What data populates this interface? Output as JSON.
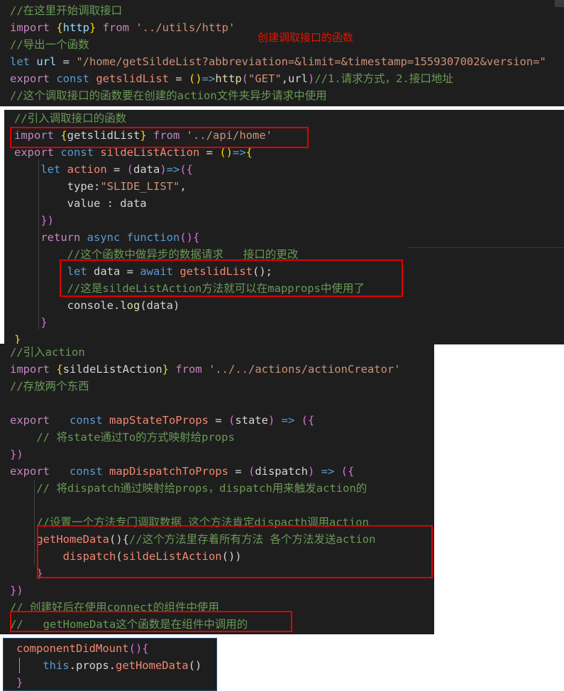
{
  "panel1": {
    "lines": [
      [
        {
          "t": "//在这里开始调取接口",
          "c": "c"
        }
      ],
      [
        {
          "t": "import ",
          "c": "kp"
        },
        {
          "t": "{",
          "c": "y"
        },
        {
          "t": "http",
          "c": "v"
        },
        {
          "t": "} ",
          "c": "y"
        },
        {
          "t": "from ",
          "c": "kp"
        },
        {
          "t": "'../utils/http'",
          "c": "s"
        }
      ],
      [
        {
          "t": "//导出一个函数",
          "c": "c"
        }
      ],
      [
        {
          "t": "let ",
          "c": "k"
        },
        {
          "t": "url ",
          "c": "v"
        },
        {
          "t": "= ",
          "c": "w"
        },
        {
          "t": "\"/home/getSildeList?abbreviation=&limit=&timestamp=1559307002&version=\"",
          "c": "s"
        }
      ],
      [
        {
          "t": "export ",
          "c": "kp"
        },
        {
          "t": "const ",
          "c": "k"
        },
        {
          "t": "getslidList ",
          "c": "f2"
        },
        {
          "t": "= ",
          "c": "w"
        },
        {
          "t": "()",
          "c": "y"
        },
        {
          "t": "=>",
          "c": "k"
        },
        {
          "t": "http",
          "c": "f"
        },
        {
          "t": "(",
          "c": "pk"
        },
        {
          "t": "\"GET\"",
          "c": "s"
        },
        {
          "t": ",url",
          "c": "w"
        },
        {
          "t": ")",
          "c": "pk"
        },
        {
          "t": "//1.请求方式，2.接口地址",
          "c": "c"
        }
      ],
      [
        {
          "t": "//这个调取接口的函数要在创建的action文件夹异步请求中使用",
          "c": "c"
        }
      ]
    ],
    "annotation": "创建调取接口的函数"
  },
  "panel2": {
    "lines": [
      [
        {
          "t": "//引入调取接口的函数",
          "c": "c"
        }
      ],
      [
        {
          "t": "import ",
          "c": "kp"
        },
        {
          "t": "{",
          "c": "y"
        },
        {
          "t": "getslidList",
          "c": "w"
        },
        {
          "t": "} ",
          "c": "y"
        },
        {
          "t": "from ",
          "c": "kp"
        },
        {
          "t": "'../api/home'",
          "c": "s"
        }
      ],
      [
        {
          "t": "export ",
          "c": "kp"
        },
        {
          "t": "const ",
          "c": "k"
        },
        {
          "t": "sildeListAction ",
          "c": "f2"
        },
        {
          "t": "= ",
          "c": "w"
        },
        {
          "t": "()",
          "c": "y"
        },
        {
          "t": "=>",
          "c": "k"
        },
        {
          "t": "{",
          "c": "y"
        }
      ],
      [
        {
          "t": "    let ",
          "c": "k"
        },
        {
          "t": "action ",
          "c": "f2"
        },
        {
          "t": "= ",
          "c": "w"
        },
        {
          "t": "(",
          "c": "pk"
        },
        {
          "t": "data",
          "c": "w"
        },
        {
          "t": ")",
          "c": "pk"
        },
        {
          "t": "=>",
          "c": "k"
        },
        {
          "t": "({",
          "c": "pk"
        }
      ],
      [
        {
          "t": "        type:",
          "c": "w"
        },
        {
          "t": "\"SLIDE_LIST\"",
          "c": "s"
        },
        {
          "t": ",",
          "c": "w"
        }
      ],
      [
        {
          "t": "        value : data",
          "c": "w"
        }
      ],
      [
        {
          "t": "    })",
          "c": "pk"
        }
      ],
      [
        {
          "t": "    return ",
          "c": "kp"
        },
        {
          "t": "async ",
          "c": "k"
        },
        {
          "t": "function",
          "c": "k"
        },
        {
          "t": "(){",
          "c": "pk"
        }
      ],
      [
        {
          "t": "        //这个函数中做异步的数据请求   接口的更改",
          "c": "c"
        }
      ],
      [
        {
          "t": "        let ",
          "c": "k"
        },
        {
          "t": "data ",
          "c": "w"
        },
        {
          "t": "= ",
          "c": "w"
        },
        {
          "t": "await ",
          "c": "k"
        },
        {
          "t": "getslidList",
          "c": "f2"
        },
        {
          "t": "();",
          "c": "w"
        }
      ],
      [
        {
          "t": "        //这是sildeListAction方法就可以在mapprops中使用了",
          "c": "c"
        }
      ],
      [
        {
          "t": "        console.",
          "c": "w"
        },
        {
          "t": "log",
          "c": "f"
        },
        {
          "t": "(data)",
          "c": "w"
        }
      ],
      [
        {
          "t": "    }",
          "c": "pk"
        }
      ],
      [
        {
          "t": "}",
          "c": "y"
        }
      ]
    ]
  },
  "panel3": {
    "lines": [
      [
        {
          "t": "//引入action",
          "c": "c"
        }
      ],
      [
        {
          "t": "import ",
          "c": "kp"
        },
        {
          "t": "{",
          "c": "y"
        },
        {
          "t": "sildeListAction",
          "c": "w"
        },
        {
          "t": "} ",
          "c": "y"
        },
        {
          "t": "from ",
          "c": "kp"
        },
        {
          "t": "'../../actions/actionCreator'",
          "c": "s"
        }
      ],
      [
        {
          "t": "//存放两个东西",
          "c": "c"
        }
      ],
      [
        {
          "t": "",
          "c": "w"
        }
      ],
      [
        {
          "t": "export ",
          "c": "kp"
        },
        {
          "t": "  const ",
          "c": "k"
        },
        {
          "t": "mapStateToProps ",
          "c": "f2"
        },
        {
          "t": "= ",
          "c": "w"
        },
        {
          "t": "(",
          "c": "pk"
        },
        {
          "t": "state",
          "c": "w"
        },
        {
          "t": ") ",
          "c": "pk"
        },
        {
          "t": "=> ",
          "c": "k"
        },
        {
          "t": "({",
          "c": "pk"
        }
      ],
      [
        {
          "t": "    // 将state通过To的方式映射给props",
          "c": "c"
        }
      ],
      [
        {
          "t": "})",
          "c": "pk"
        }
      ],
      [
        {
          "t": "export ",
          "c": "kp"
        },
        {
          "t": "  const ",
          "c": "k"
        },
        {
          "t": "mapDispatchToProps ",
          "c": "f2"
        },
        {
          "t": "= ",
          "c": "w"
        },
        {
          "t": "(",
          "c": "pk"
        },
        {
          "t": "dispatch",
          "c": "w"
        },
        {
          "t": ") ",
          "c": "pk"
        },
        {
          "t": "=> ",
          "c": "k"
        },
        {
          "t": "({",
          "c": "pk"
        }
      ],
      [
        {
          "t": "    // 将dispatch通过映射给props，dispatch用来触发action的",
          "c": "c"
        }
      ],
      [
        {
          "t": "",
          "c": "w"
        }
      ],
      [
        {
          "t": "    //设置一个方法专门调取数据 这个方法肯定dispacth调用action",
          "c": "c"
        }
      ],
      [
        {
          "t": "    getHomeData",
          "c": "f2"
        },
        {
          "t": "(){",
          "c": "w"
        },
        {
          "t": "//这个方法里存着所有方法 各个方法发送action",
          "c": "c"
        }
      ],
      [
        {
          "t": "        dispatch",
          "c": "f2"
        },
        {
          "t": "(",
          "c": "w"
        },
        {
          "t": "sildeListAction",
          "c": "f2"
        },
        {
          "t": "())",
          "c": "w"
        }
      ],
      [
        {
          "t": "    }",
          "c": "pk"
        }
      ],
      [
        {
          "t": "})",
          "c": "pk"
        }
      ],
      [
        {
          "t": "// 创建好后在使用connect的组件中使用",
          "c": "c"
        }
      ],
      [
        {
          "t": "//   getHomeData这个函数是在组件中调用的",
          "c": "c"
        }
      ]
    ]
  },
  "panel4": {
    "lines": [
      [
        {
          "t": "componentDidMount",
          "c": "f2"
        },
        {
          "t": "(){",
          "c": "pk"
        }
      ],
      [
        {
          "t": "    this",
          "c": "k"
        },
        {
          "t": ".props.",
          "c": "w"
        },
        {
          "t": "getHomeData",
          "c": "f2"
        },
        {
          "t": "()",
          "c": "w"
        }
      ],
      [
        {
          "t": "}",
          "c": "pk"
        }
      ]
    ]
  }
}
